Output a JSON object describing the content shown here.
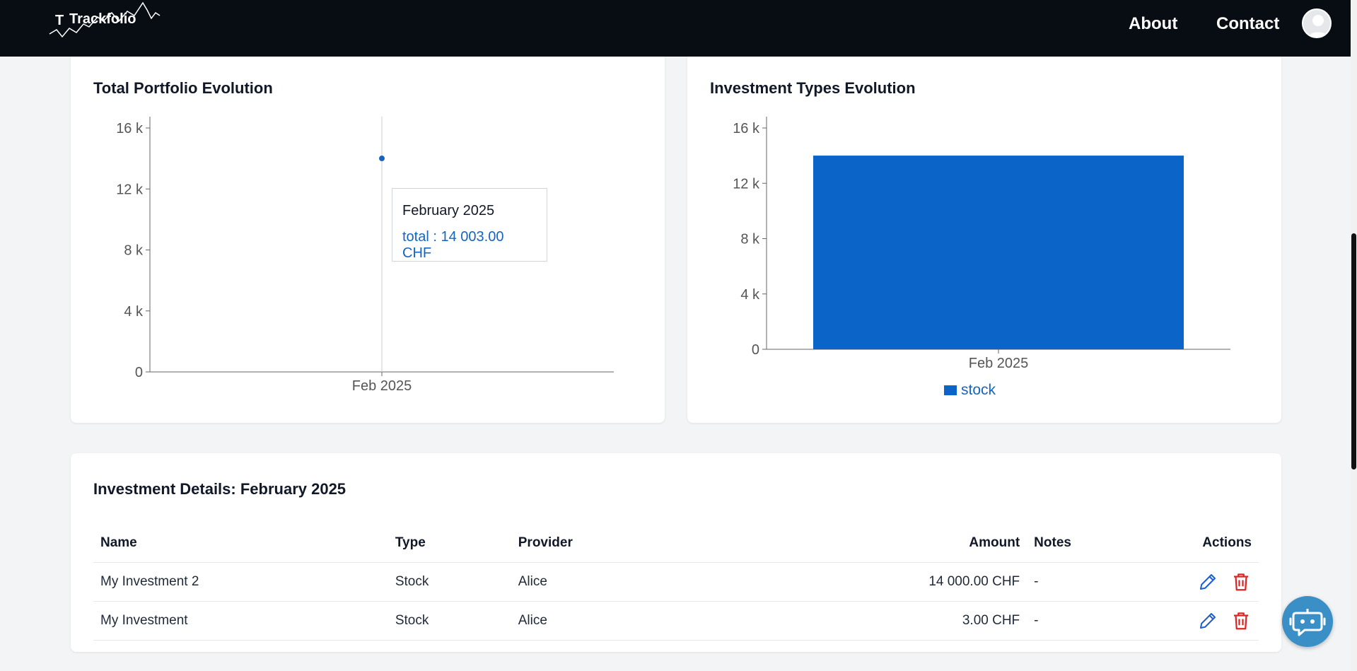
{
  "brand": {
    "name": "Trackfolio",
    "mark": "T"
  },
  "nav": {
    "about": "About",
    "contact": "Contact"
  },
  "portfolio_card": {
    "title": "Total Portfolio Evolution",
    "tooltip": {
      "month": "February 2025",
      "total": "total : 14 003.00 CHF"
    }
  },
  "types_card": {
    "title": "Investment Types Evolution",
    "legend": "stock"
  },
  "details": {
    "title": "Investment Details: February 2025",
    "columns": {
      "name": "Name",
      "type": "Type",
      "provider": "Provider",
      "amount": "Amount",
      "notes": "Notes",
      "actions": "Actions"
    },
    "rows": [
      {
        "name": "My Investment 2",
        "type": "Stock",
        "provider": "Alice",
        "amount": "14 000.00 CHF",
        "notes": "-"
      },
      {
        "name": "My Investment",
        "type": "Stock",
        "provider": "Alice",
        "amount": "3.00 CHF",
        "notes": "-"
      }
    ]
  },
  "colors": {
    "accent": "#1565c0",
    "bar": "#0b65c8",
    "delete": "#dc2626",
    "nav_bg": "#080d14"
  },
  "icons": {
    "edit": "pencil-icon",
    "delete": "trash-icon",
    "chat": "bot-icon",
    "avatar": "user-icon"
  },
  "chart_data": [
    {
      "type": "line",
      "title": "Total Portfolio Evolution",
      "categories": [
        "Feb 2025"
      ],
      "series": [
        {
          "name": "total",
          "values": [
            14003
          ]
        }
      ],
      "y_ticks": [
        "0",
        "4 k",
        "8 k",
        "12 k",
        "16 k"
      ],
      "ylim": [
        0,
        16000
      ]
    },
    {
      "type": "bar",
      "title": "Investment Types Evolution",
      "categories": [
        "Feb 2025"
      ],
      "series": [
        {
          "name": "stock",
          "values": [
            14003
          ]
        }
      ],
      "y_ticks": [
        "0",
        "4 k",
        "8 k",
        "12 k",
        "16 k"
      ],
      "ylim": [
        0,
        16000
      ]
    }
  ]
}
